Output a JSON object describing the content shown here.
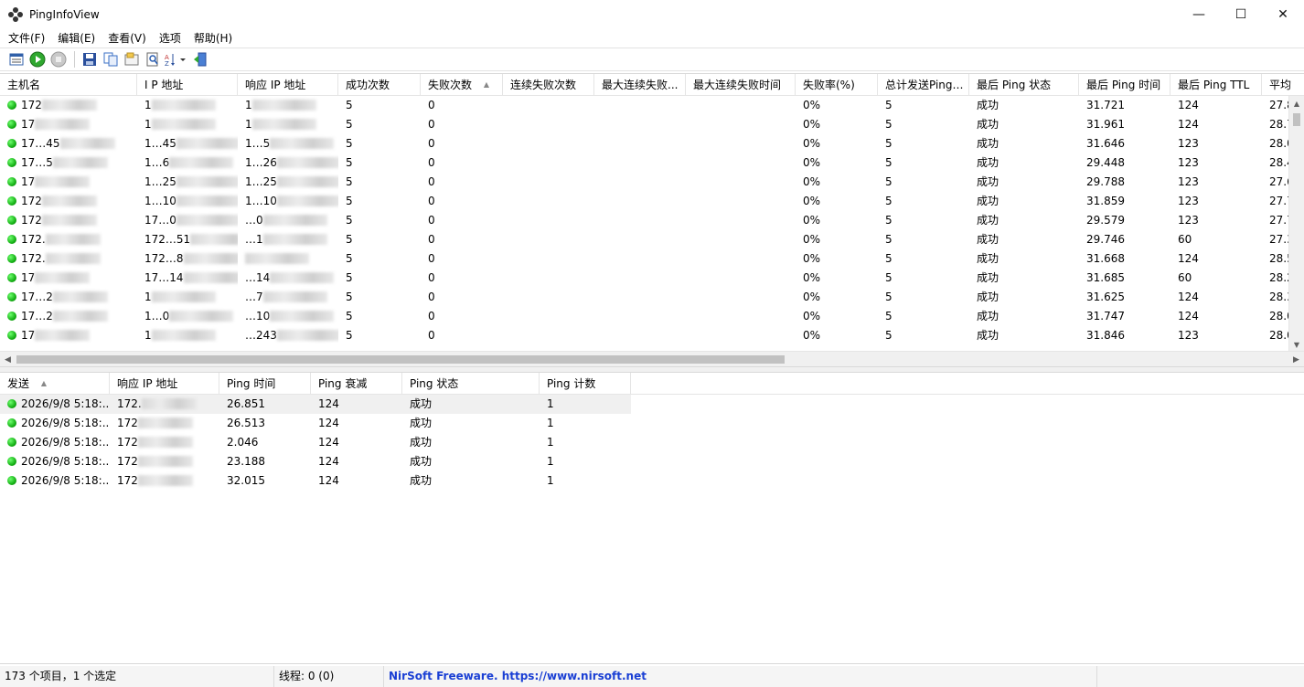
{
  "window": {
    "title": "PingInfoView",
    "controls": {
      "minimize": "—",
      "maximize": "☐",
      "close": "✕"
    }
  },
  "menu": [
    "文件(F)",
    "编辑(E)",
    "查看(V)",
    "选项",
    "帮助(H)"
  ],
  "toolbar": {
    "icons": [
      "properties-icon",
      "start-ping-icon",
      "stop-ping-icon",
      "save-icon",
      "copy-icon",
      "html-report-icon",
      "find-icon",
      "sort-icon",
      "exit-icon"
    ]
  },
  "upper_table": {
    "columns": [
      "主机名",
      "I P 地址",
      "响应 IP 地址",
      "成功次数",
      "失败次数",
      "连续失败次数",
      "最大连续失败...",
      "最大连续失败时间",
      "失败率(%)",
      "总计发送Pings...",
      "最后 Ping 状态",
      "最后 Ping 时间",
      "最后 Ping TTL",
      "平均"
    ],
    "rows": [
      {
        "host": "172",
        "ip": "1",
        "resp_ip": "1",
        "ok": "5",
        "fail": "0",
        "rate": "0%",
        "total": "5",
        "status": "成功",
        "time": "31.721",
        "ttl": "124",
        "avg": "27.8"
      },
      {
        "host": "17",
        "ip": "1",
        "resp_ip": "1",
        "ok": "5",
        "fail": "0",
        "rate": "0%",
        "total": "5",
        "status": "成功",
        "time": "31.961",
        "ttl": "124",
        "avg": "28.7"
      },
      {
        "host": "17…45",
        "ip": "1…45",
        "resp_ip": "1…5",
        "ok": "5",
        "fail": "0",
        "rate": "0%",
        "total": "5",
        "status": "成功",
        "time": "31.646",
        "ttl": "123",
        "avg": "28.0"
      },
      {
        "host": "17…5",
        "ip": "1…6",
        "resp_ip": "1…26",
        "ok": "5",
        "fail": "0",
        "rate": "0%",
        "total": "5",
        "status": "成功",
        "time": "29.448",
        "ttl": "123",
        "avg": "28.4"
      },
      {
        "host": "17",
        "ip": "1…25",
        "resp_ip": "1…25",
        "ok": "5",
        "fail": "0",
        "rate": "0%",
        "total": "5",
        "status": "成功",
        "time": "29.788",
        "ttl": "123",
        "avg": "27.6"
      },
      {
        "host": "172",
        "ip": "1…10",
        "resp_ip": "1…10",
        "ok": "5",
        "fail": "0",
        "rate": "0%",
        "total": "5",
        "status": "成功",
        "time": "31.859",
        "ttl": "123",
        "avg": "27.7"
      },
      {
        "host": "172",
        "ip": "17…0",
        "resp_ip": "…0",
        "ok": "5",
        "fail": "0",
        "rate": "0%",
        "total": "5",
        "status": "成功",
        "time": "29.579",
        "ttl": "123",
        "avg": "27.7"
      },
      {
        "host": "172.",
        "ip": "172…51",
        "resp_ip": "…1",
        "ok": "5",
        "fail": "0",
        "rate": "0%",
        "total": "5",
        "status": "成功",
        "time": "29.746",
        "ttl": "60",
        "avg": "27.3"
      },
      {
        "host": "172.",
        "ip": "172…8",
        "resp_ip": "",
        "ok": "5",
        "fail": "0",
        "rate": "0%",
        "total": "5",
        "status": "成功",
        "time": "31.668",
        "ttl": "124",
        "avg": "28.5"
      },
      {
        "host": "17",
        "ip": "17…14",
        "resp_ip": "…14",
        "ok": "5",
        "fail": "0",
        "rate": "0%",
        "total": "5",
        "status": "成功",
        "time": "31.685",
        "ttl": "60",
        "avg": "28.2"
      },
      {
        "host": "17…2",
        "ip": "1",
        "resp_ip": "…7",
        "ok": "5",
        "fail": "0",
        "rate": "0%",
        "total": "5",
        "status": "成功",
        "time": "31.625",
        "ttl": "124",
        "avg": "28.3"
      },
      {
        "host": "17…2",
        "ip": "1…0",
        "resp_ip": "…10",
        "ok": "5",
        "fail": "0",
        "rate": "0%",
        "total": "5",
        "status": "成功",
        "time": "31.747",
        "ttl": "124",
        "avg": "28.0"
      },
      {
        "host": "17",
        "ip": "1",
        "resp_ip": "…243",
        "ok": "5",
        "fail": "0",
        "rate": "0%",
        "total": "5",
        "status": "成功",
        "time": "31.846",
        "ttl": "123",
        "avg": "28.0"
      }
    ]
  },
  "lower_table": {
    "columns": [
      "发送",
      "响应 IP 地址",
      "Ping 时间",
      "Ping 衰减",
      "Ping 状态",
      "Ping 计数"
    ],
    "rows": [
      {
        "sent": "2026/9/8 5:18:...",
        "resp_ip": "172.",
        "time": "26.851",
        "ttl": "124",
        "status": "成功",
        "count": "1"
      },
      {
        "sent": "2026/9/8 5:18:...",
        "resp_ip": "172",
        "time": "26.513",
        "ttl": "124",
        "status": "成功",
        "count": "1"
      },
      {
        "sent": "2026/9/8 5:18:...",
        "resp_ip": "172",
        "time": "2.046",
        "ttl": "124",
        "status": "成功",
        "count": "1"
      },
      {
        "sent": "2026/9/8 5:18:...",
        "resp_ip": "172",
        "time": "23.188",
        "ttl": "124",
        "status": "成功",
        "count": "1"
      },
      {
        "sent": "2026/9/8 5:18:...",
        "resp_ip": "172",
        "time": "32.015",
        "ttl": "124",
        "status": "成功",
        "count": "1"
      }
    ]
  },
  "statusbar": {
    "items": "173 个项目，1 个选定",
    "threads": "线程: 0 (0)",
    "link": "NirSoft Freeware. https://www.nirsoft.net"
  }
}
